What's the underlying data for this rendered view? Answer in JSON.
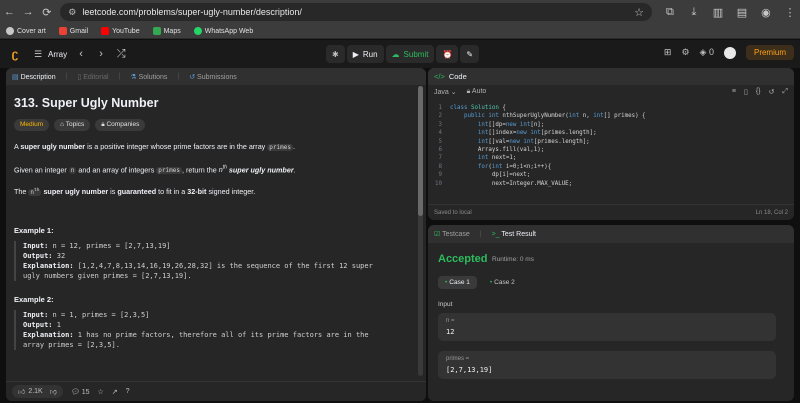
{
  "browser": {
    "url": "leetcode.com/problems/super-ugly-number/description/",
    "bookmarks": [
      "Cover art",
      "Gmail",
      "YouTube",
      "Maps",
      "WhatsApp Web"
    ]
  },
  "topbar": {
    "list_name": "Array",
    "run_label": "Run",
    "submit_label": "Submit",
    "streak": "0",
    "premium_label": "Premium"
  },
  "left_tabs": [
    "Description",
    "Editorial",
    "Solutions",
    "Submissions"
  ],
  "problem": {
    "title": "313. Super Ugly Number",
    "badges": [
      "Medium",
      "Topics",
      "Companies"
    ],
    "p1_bold": "super ugly number",
    "p1_a": "A",
    "p1_b": "is a positive integer whose prime factors are in the array",
    "p1_code": "primes",
    "p2_a": "Given an integer",
    "p2_code1": "n",
    "p2_b": "and an array of integers",
    "p2_code2": "primes",
    "p2_c": ", return the",
    "p2_sup": "th",
    "p2_d": "super ugly number",
    "p3_a": "The",
    "p3_sup": "th",
    "p3_b": "super ugly number",
    "p3_c": "is",
    "p3_d": "guaranteed",
    "p3_e": "to fit in a",
    "p3_f": "32-bit",
    "p3_g": "signed integer.",
    "ex1_title": "Example 1:",
    "ex1_input_label": "Input:",
    "ex1_input": "n = 12, primes = [2,7,13,19]",
    "ex1_output_label": "Output:",
    "ex1_output": "32",
    "ex1_expl_label": "Explanation:",
    "ex1_expl1": "[1,2,4,7,8,13,14,16,19,26,28,32] is the sequence of the first 12 super",
    "ex1_expl2": "ugly numbers given primes = [2,7,13,19].",
    "ex2_title": "Example 2:",
    "ex2_input_label": "Input:",
    "ex2_input": "n = 1, primes = [2,3,5]",
    "ex2_output_label": "Output:",
    "ex2_output": "1",
    "ex2_expl_label": "Explanation:",
    "ex2_expl1": "1 has no prime factors, therefore all of its prime factors are in the",
    "ex2_expl2": "array primes = [2,3,5]."
  },
  "footer": {
    "likes": "2.1K",
    "comments": "15"
  },
  "code_panel": {
    "title": "Code",
    "language": "Java",
    "mode": "Auto",
    "saved": "Saved to local",
    "cursor": "Ln 18, Col 2"
  },
  "test_panel": {
    "tab_testcase": "Testcase",
    "tab_result": "Test Result",
    "status": "Accepted",
    "runtime": "Runtime: 0 ms",
    "case1": "Case 1",
    "case2": "Case 2",
    "input_label": "Input",
    "var1_name": "n =",
    "var1_val": "12",
    "var2_name": "primes =",
    "var2_val": "[2,7,13,19]"
  }
}
